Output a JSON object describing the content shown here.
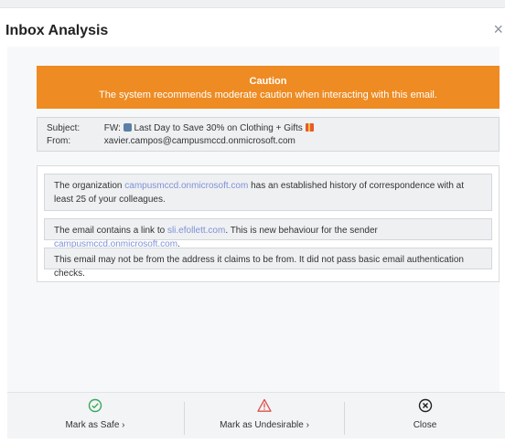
{
  "dialog": {
    "title": "Inbox Analysis",
    "close_glyph": "×"
  },
  "caution": {
    "heading": "Caution",
    "message": "The system recommends moderate caution when interacting with this email.",
    "color": "#ee8b22"
  },
  "email": {
    "subject_label": "Subject:",
    "subject_prefix": "FW:",
    "subject_text": "Last Day to Save 30% on Clothing + Gifts",
    "from_label": "From:",
    "from_value": "xavier.campos@campusmccd.onmicrosoft.com"
  },
  "findings": [
    {
      "pre": "The organization ",
      "link": "campusmccd.onmicrosoft.com",
      "post": " has an established history of correspondence with at least 25 of your colleagues."
    },
    {
      "pre": "The email contains a link to ",
      "link": "sli.efollett.com",
      "mid": ". This is new behaviour for the sender ",
      "link2": "campusmccd.onmicrosoft.com",
      "post": "."
    },
    {
      "text": "This email may not be from the address it claims to be from. It did not pass basic email authentication checks."
    }
  ],
  "footer": {
    "safe": {
      "label": "Mark as Safe",
      "icon": "check-circle-icon",
      "color": "#3aa85a"
    },
    "undesirable": {
      "label": "Mark as Undesirable",
      "icon": "warning-triangle-icon",
      "color": "#d9534f"
    },
    "close": {
      "label": "Close",
      "icon": "close-circle-icon"
    },
    "chevron": "›"
  }
}
